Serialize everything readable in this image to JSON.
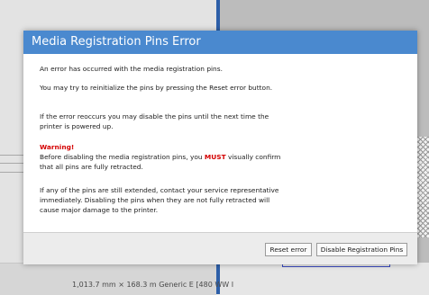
{
  "background": {
    "status_text": "1,013.7 mm × 168.3 m   Generic E [480 WW I"
  },
  "dialog": {
    "title": "Media Registration Pins Error",
    "messages": {
      "p1": "An error has occurred with the media registration pins.",
      "p2": "You may try to reinitialize the pins by pressing the Reset error button.",
      "p3": "If the error reoccurs you may disable the pins until the next time the printer is powered up.",
      "warning_title": "Warning!",
      "p4_before": "Before disabling the media registration pins, you ",
      "p4_must": "MUST",
      "p4_after": " visually confirm that all pins are fully retracted.",
      "p5": "If any of the pins are still extended, contact your service representative immediately. Disabling the pins when they are not fully retracted will cause major damage to the printer."
    },
    "buttons": {
      "reset": "Reset error",
      "disable": "Disable Registration Pins"
    }
  },
  "colors": {
    "title_bar": "#4a89cf",
    "warning": "#d40000"
  }
}
